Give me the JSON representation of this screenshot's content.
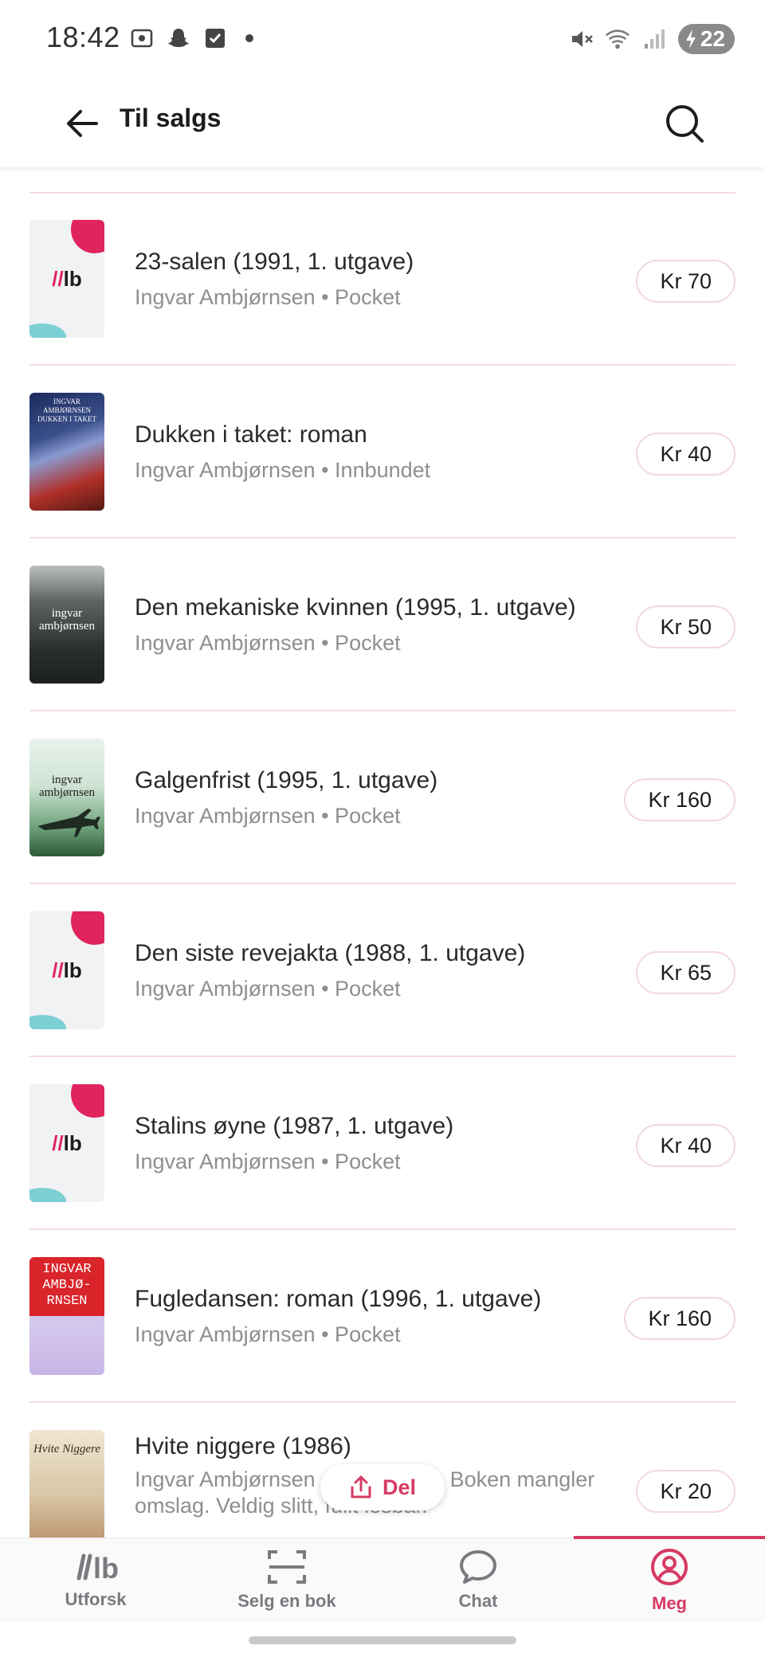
{
  "status_bar": {
    "time": "18:42",
    "battery": "22",
    "left_icons": [
      "screenshot-icon",
      "snapchat-icon",
      "checkbox-icon"
    ],
    "right_icons": [
      "mute-icon",
      "wifi-icon",
      "signal-icon"
    ]
  },
  "header": {
    "title": "Til salgs"
  },
  "listings": [
    {
      "title": "23-salen (1991, 1. utgave)",
      "subtitle": "Ingvar Ambjørnsen • Pocket",
      "price": "Kr 70",
      "cover": "placeholder"
    },
    {
      "title": "Dukken i taket: roman",
      "subtitle": "Ingvar Ambjørnsen • Innbundet",
      "price": "Kr 40",
      "cover": "dukken",
      "cover_text": "INGVAR AMBJØRNSEN DUKKEN I TAKET"
    },
    {
      "title": "Den mekaniske kvinnen (1995, 1. utgave)",
      "subtitle": "Ingvar Ambjørnsen • Pocket",
      "price": "Kr 50",
      "cover": "meka",
      "cover_text": "ingvar ambjørnsen"
    },
    {
      "title": "Galgenfrist (1995, 1. utgave)",
      "subtitle": "Ingvar Ambjørnsen • Pocket",
      "price": "Kr 160",
      "cover": "galgen",
      "cover_text": "ingvar ambjørnsen"
    },
    {
      "title": "Den siste revejakta (1988, 1. utgave)",
      "subtitle": "Ingvar Ambjørnsen • Pocket",
      "price": "Kr 65",
      "cover": "placeholder"
    },
    {
      "title": "Stalins øyne (1987, 1. utgave)",
      "subtitle": "Ingvar Ambjørnsen • Pocket",
      "price": "Kr 40",
      "cover": "placeholder"
    },
    {
      "title": "Fugledansen: roman (1996, 1. utgave)",
      "subtitle": "Ingvar Ambjørnsen • Pocket",
      "price": "Kr 160",
      "cover": "fugle",
      "cover_text": "INGVAR AMBJØ-RNSEN"
    },
    {
      "title": "Hvite niggere (1986)",
      "subtitle": "Ingvar Ambjørnsen • Innbundet • Boken mangler omslag. Veldig slitt, fullt lesbar.",
      "price": "Kr 20",
      "cover": "hvite",
      "cover_text": "Hvite Niggere"
    }
  ],
  "placeholder_logo": {
    "slash": "//",
    "letters": "lb"
  },
  "share": {
    "label": "Del"
  },
  "bottom_nav": [
    {
      "label": "Utforsk",
      "icon": "logo-icon",
      "active": false
    },
    {
      "label": "Selg en bok",
      "icon": "scan-icon",
      "active": false
    },
    {
      "label": "Chat",
      "icon": "chat-bubble-icon",
      "active": false
    },
    {
      "label": "Meg",
      "icon": "profile-icon",
      "active": true
    }
  ],
  "colors": {
    "accent": "#d63a63",
    "divider": "#f3dce2"
  }
}
